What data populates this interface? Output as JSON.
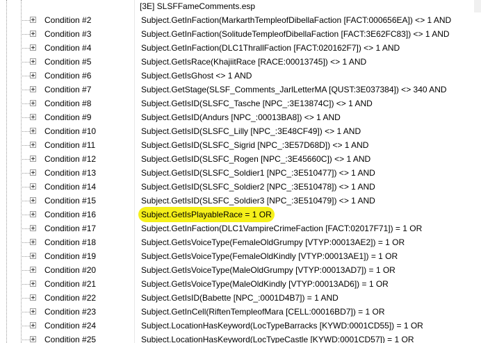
{
  "header": {
    "file_label": "[3E] SLSFFameComments.esp"
  },
  "rows": [
    {
      "label": "Condition #2",
      "value": "Subject.GetInFaction(MarkarthTempleofDibellaFaction [FACT:000656EA]) <> 1 AND"
    },
    {
      "label": "Condition #3",
      "value": "Subject.GetInFaction(SolitudeTempleofDibellaFaction [FACT:3E62FC83]) <> 1 AND"
    },
    {
      "label": "Condition #4",
      "value": "Subject.GetInFaction(DLC1ThrallFaction [FACT:020162F7]) <> 1 AND"
    },
    {
      "label": "Condition #5",
      "value": "Subject.GetIsRace(KhajiitRace [RACE:00013745]) <> 1 AND"
    },
    {
      "label": "Condition #6",
      "value": "Subject.GetIsGhost <> 1 AND"
    },
    {
      "label": "Condition #7",
      "value": "Subject.GetStage(SLSF_Comments_JarlLetterMA [QUST:3E037384]) <> 340 AND"
    },
    {
      "label": "Condition #8",
      "value": "Subject.GetIsID(SLSFC_Tasche [NPC_:3E13874C]) <> 1 AND"
    },
    {
      "label": "Condition #9",
      "value": "Subject.GetIsID(Andurs [NPC_:00013BA8]) <> 1 AND"
    },
    {
      "label": "Condition #10",
      "value": "Subject.GetIsID(SLSFC_Lilly [NPC_:3E48CF49]) <> 1 AND"
    },
    {
      "label": "Condition #11",
      "value": "Subject.GetIsID(SLSFC_Sigrid [NPC_:3E57D68D]) <> 1 AND"
    },
    {
      "label": "Condition #12",
      "value": "Subject.GetIsID(SLSFC_Rogen [NPC_:3E45660C]) <> 1 AND"
    },
    {
      "label": "Condition #13",
      "value": "Subject.GetIsID(SLSFC_Soldier1 [NPC_:3E510477]) <> 1 AND"
    },
    {
      "label": "Condition #14",
      "value": "Subject.GetIsID(SLSFC_Soldier2 [NPC_:3E510478]) <> 1 AND"
    },
    {
      "label": "Condition #15",
      "value": "Subject.GetIsID(SLSFC_Soldier3 [NPC_:3E510479]) <> 1 AND"
    },
    {
      "label": "Condition #16",
      "value": "Subject.GetIsPlayableRace = 1 OR",
      "highlighted": true
    },
    {
      "label": "Condition #17",
      "value": "Subject.GetInFaction(DLC1VampireCrimeFaction [FACT:02017F71]) = 1 OR"
    },
    {
      "label": "Condition #18",
      "value": "Subject.GetIsVoiceType(FemaleOldGrumpy [VTYP:00013AE2]) = 1 OR"
    },
    {
      "label": "Condition #19",
      "value": "Subject.GetIsVoiceType(FemaleOldKindly [VTYP:00013AE1]) = 1 OR"
    },
    {
      "label": "Condition #20",
      "value": "Subject.GetIsVoiceType(MaleOldGrumpy [VTYP:00013AD7]) = 1 OR"
    },
    {
      "label": "Condition #21",
      "value": "Subject.GetIsVoiceType(MaleOldKindly [VTYP:00013AD6]) = 1 OR"
    },
    {
      "label": "Condition #22",
      "value": "Subject.GetIsID(Babette [NPC_:0001D4B7]) = 1 AND"
    },
    {
      "label": "Condition #23",
      "value": "Subject.GetInCell(RiftenTempleofMara [CELL:00016BD7]) = 1 OR"
    },
    {
      "label": "Condition #24",
      "value": "Subject.LocationHasKeyword(LocTypeBarracks [KYWD:0001CD55]) = 1 OR"
    },
    {
      "label": "Condition #25",
      "value": "Subject.LocationHasKeyword(LocTypeCastle [KYWD:0001CD57]) = 1 OR"
    }
  ],
  "colors": {
    "highlight": "#f5f01a",
    "guide": "#9a9a9a"
  },
  "icons": {
    "expander": "plus-box-icon"
  }
}
